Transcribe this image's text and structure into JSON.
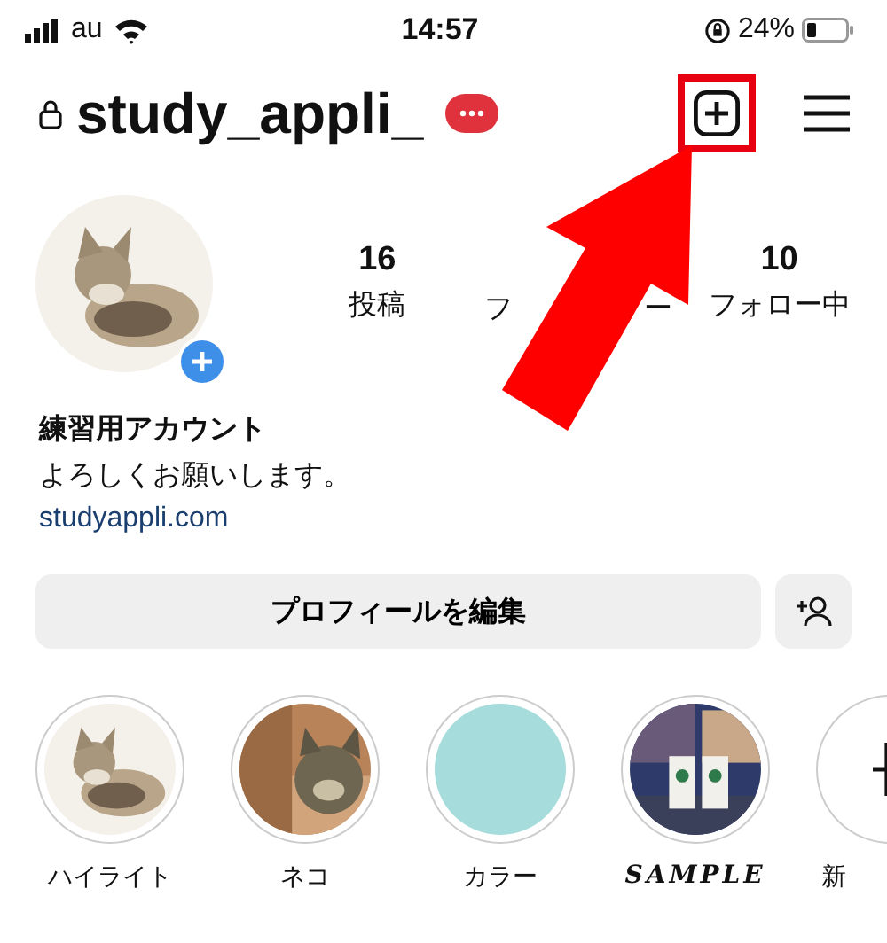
{
  "status_bar": {
    "carrier": "au",
    "time": "14:57",
    "battery": "24%"
  },
  "header": {
    "username": "study_appli_",
    "new_post_highlighted": true
  },
  "profile": {
    "stats": [
      {
        "kind": "stat",
        "count": "16",
        "label": "投稿"
      },
      {
        "kind": "covered",
        "label_start": "フ",
        "label_end": "ー"
      },
      {
        "kind": "stat",
        "count": "10",
        "label": "フォロー中"
      }
    ],
    "name": "練習用アカウント",
    "bio": "よろしくお願いします。",
    "link": "studyappli.com"
  },
  "buttons": {
    "edit": "プロフィールを編集"
  },
  "highlights": [
    {
      "kind": "picture",
      "label": "ハイライト"
    },
    {
      "kind": "picture",
      "label": "ネコ"
    },
    {
      "kind": "plain",
      "label": "カラー"
    },
    {
      "kind": "picture",
      "label": "SAMPLE"
    },
    {
      "kind": "new",
      "label": "新"
    }
  ],
  "annotation": {
    "kind": "arrow"
  }
}
